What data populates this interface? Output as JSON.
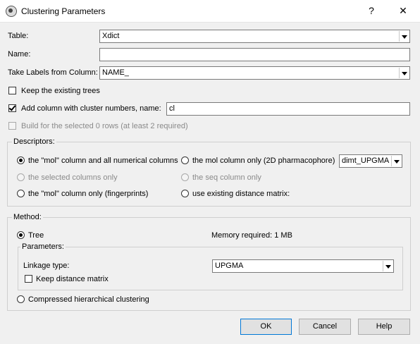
{
  "window": {
    "title": "Clustering Parameters",
    "help_glyph": "?",
    "close_glyph": "✕"
  },
  "form": {
    "table_label": "Table:",
    "table_value": "Xdict",
    "name_label": "Name:",
    "name_value": "",
    "labels_from_label": "Take Labels from Column:",
    "labels_from_value": "NAME_",
    "keep_trees_label": "Keep the existing trees",
    "keep_trees_checked": false,
    "add_column_label": "Add column with cluster numbers, name:",
    "add_column_checked": true,
    "add_column_value": "cl",
    "build_selected_label": "Build for the selected 0 rows (at least 2 required)",
    "build_selected_checked": false
  },
  "descriptors": {
    "title": "Descriptors:",
    "options": [
      {
        "label": "the \"mol\" column and all numerical columns",
        "selected": true,
        "enabled": true
      },
      {
        "label": "the mol column only (2D pharmacophore)",
        "selected": false,
        "enabled": true
      },
      {
        "label": "the selected columns only",
        "selected": false,
        "enabled": false
      },
      {
        "label": "the seq column only",
        "selected": false,
        "enabled": false
      },
      {
        "label": "the \"mol\" column only (fingerprints)",
        "selected": false,
        "enabled": true
      },
      {
        "label": "use existing distance matrix:",
        "selected": false,
        "enabled": true
      }
    ],
    "matrix_value": "dimt_UPGMA"
  },
  "method": {
    "title": "Method:",
    "tree_label": "Tree",
    "tree_selected": true,
    "memory_text": "Memory required: 1 MB",
    "parameters_title": "Parameters:",
    "linkage_label": "Linkage type:",
    "linkage_value": "UPGMA",
    "keep_matrix_label": "Keep distance matrix",
    "keep_matrix_checked": false,
    "compressed_label": "Compressed hierarchical clustering",
    "compressed_selected": false
  },
  "buttons": {
    "ok": "OK",
    "cancel": "Cancel",
    "help": "Help"
  }
}
